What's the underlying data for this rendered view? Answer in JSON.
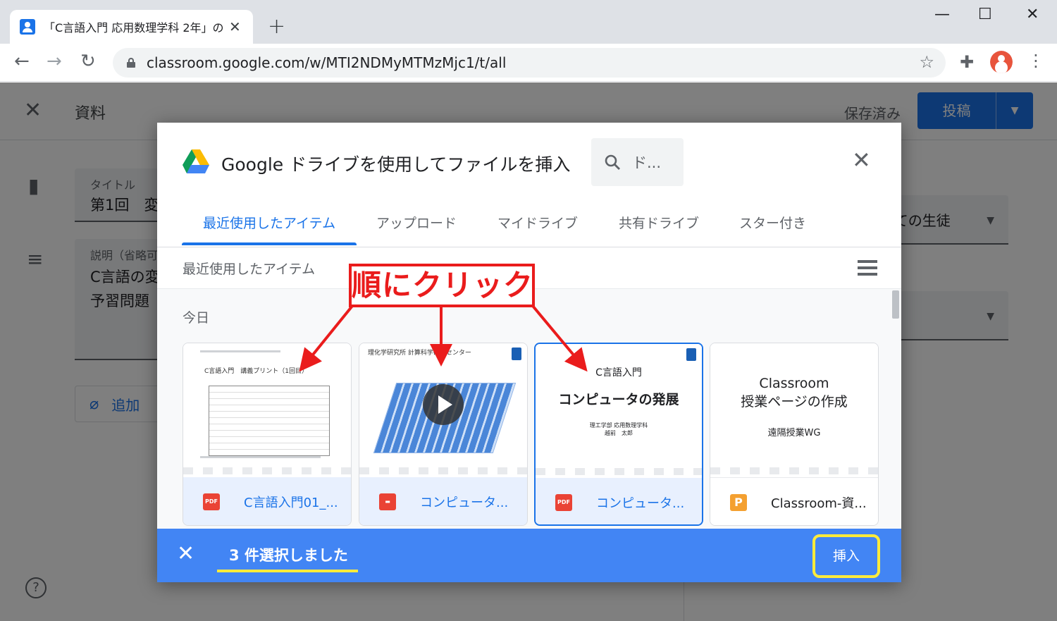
{
  "browser": {
    "tab_title": "「C言語入門 応用数理学科 2年」の",
    "tab_close": "✕",
    "new_tab": "+",
    "url": "classroom.google.com/w/MTI2NDMyMTMzMjc1/t/all",
    "window_controls": {
      "minimize": "—",
      "maximize": "☐",
      "close": "✕"
    }
  },
  "page": {
    "header_title": "資料",
    "saved_status": "保存済み",
    "post_label": "投稿",
    "title_label": "タイトル",
    "title_value": "第1回　変",
    "desc_label": "説明（省略可",
    "desc_line1": "C言語の変",
    "desc_line2": "予習問題",
    "add_label": "追加",
    "audience": "すべての生徒",
    "help": "?"
  },
  "dialog": {
    "title": "Google ドライブを使用してファイルを挿入",
    "search_placeholder": "ド...",
    "tabs": [
      {
        "label": "最近使用したアイテム"
      },
      {
        "label": "アップロード"
      },
      {
        "label": "マイドライブ"
      },
      {
        "label": "共有ドライブ"
      },
      {
        "label": "スター付き"
      }
    ],
    "section_label": "最近使用したアイテム",
    "group_label": "今日",
    "files": [
      {
        "name": "C言語入門01_...",
        "type": "pdf",
        "type_label": "PDF",
        "selected": false,
        "thumb_title": "C言語入門　講義プリント（1回目）"
      },
      {
        "name": "コンピュータ...",
        "type": "video",
        "type_label": "",
        "selected": false,
        "thumb_title": "理化学研究所 計算科学研究センター"
      },
      {
        "name": "コンピュータ...",
        "type": "pdf",
        "type_label": "PDF",
        "selected": true,
        "thumb_title": "C言語入門",
        "thumb_subtitle": "コンピュータの発展",
        "thumb_author": "理工学部 応用数理学科",
        "thumb_author2": "越前　太郎"
      },
      {
        "name": "Classroom-資...",
        "type": "ppt",
        "type_label": "P",
        "selected": false,
        "thumb_title": "Classroom",
        "thumb_subtitle": "授業ページの作成",
        "thumb_author": "遠隔授業WG"
      }
    ],
    "footer": {
      "selected_count": "3 件選択しました",
      "insert_label": "挿入"
    }
  },
  "annotation": {
    "callout": "順にクリック",
    "color": "#ea1c1c",
    "highlight_color": "#ffeb3b"
  },
  "colors": {
    "accent": "#1a73e8",
    "footer_blue": "#4285f4"
  }
}
